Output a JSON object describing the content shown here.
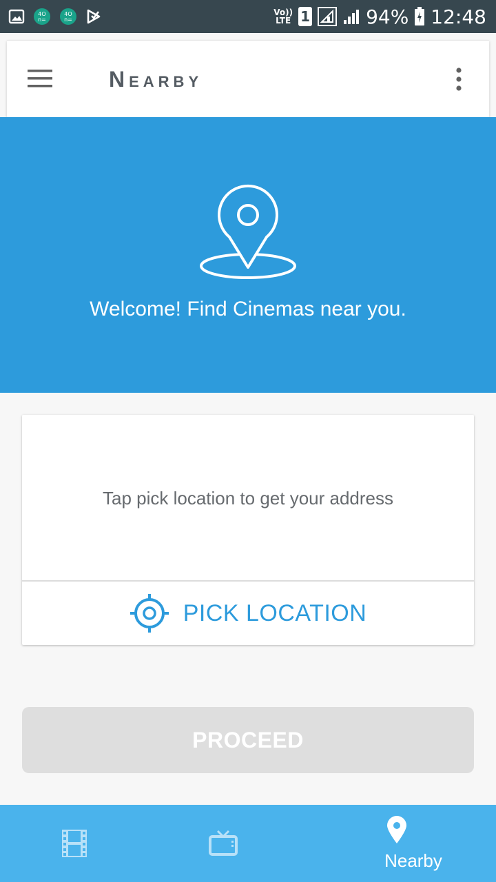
{
  "status_bar": {
    "left_icons": [
      "image-icon",
      "app-notification-icon",
      "app-notification-icon",
      "play-store-icon"
    ],
    "volte": "Vo))",
    "lte": "LTE",
    "sim": "1",
    "battery": "94%",
    "time": "12:48"
  },
  "app_bar": {
    "title": "Nearby",
    "menu_icon": "hamburger-menu-icon",
    "overflow_icon": "more-vertical-icon"
  },
  "hero": {
    "icon": "location-pin-icon",
    "text": "Welcome! Find Cinemas near you.",
    "color": "#2d9bdc"
  },
  "location_card": {
    "message": "Tap pick location to get your address",
    "pick_label": "PICK LOCATION",
    "pick_icon": "crosshair-icon"
  },
  "proceed": {
    "label": "PROCEED"
  },
  "bottom_nav": {
    "items": [
      {
        "icon": "film-icon",
        "label": ""
      },
      {
        "icon": "tv-icon",
        "label": ""
      },
      {
        "icon": "location-pin-icon",
        "label": "Nearby",
        "selected": true
      }
    ],
    "color": "#4ab3ec"
  }
}
